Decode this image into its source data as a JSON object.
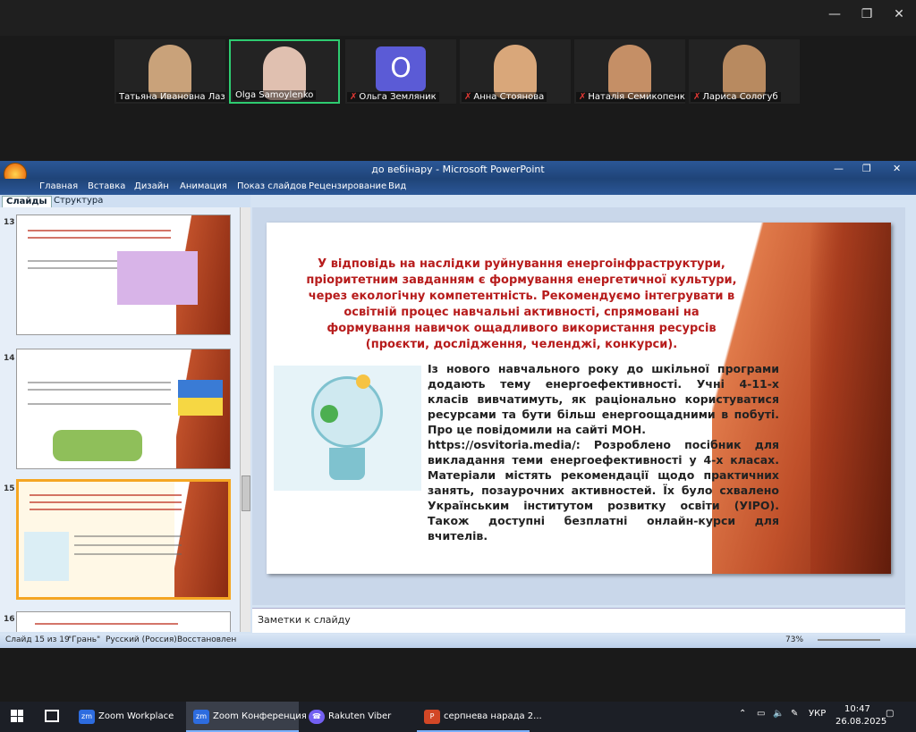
{
  "zoom": {
    "participants": [
      {
        "name": "Татьяна Ивановна Лаза...",
        "muted": false,
        "active": false
      },
      {
        "name": "Olga Samoylenko",
        "muted": false,
        "active": true
      },
      {
        "name": "Ольга Земляник",
        "muted": true,
        "active": false,
        "avatar_letter": "О"
      },
      {
        "name": "Анна Стоянова",
        "muted": true,
        "active": false
      },
      {
        "name": "Наталія Семикопенко",
        "muted": true,
        "active": false
      },
      {
        "name": "Лариса Сологуб",
        "muted": true,
        "active": false
      }
    ]
  },
  "ppt": {
    "title": "до вебінару - Microsoft PowerPoint",
    "menu": [
      "Главная",
      "Вставка",
      "Дизайн",
      "Анимация",
      "Показ слайдов",
      "Рецензирование",
      "Вид"
    ],
    "panel_tabs": [
      "Слайды",
      "Структура"
    ],
    "thumb_numbers": [
      "13",
      "14",
      "15",
      "16"
    ],
    "slide": {
      "paragraph1": "У відповідь на наслідки руйнування енергоінфраструктури, пріоритетним завданням є формування енергетичної культури, через екологічну компетентність. Рекомендуємо інтегрувати в освітній процес навчальні активності, спрямовані на формування навичок ощадливого використання ресурсів (проєкти, дослідження, челенджі, конкурси).",
      "paragraph2": "Із нового навчального року до шкільної програми додають тему енергоефективності. Учні 4-11-х класів вивчатимуть, як раціонально користуватися ресурсами та бути більш енергоощадними в побуті. Про це повідомили на сайті МОН.",
      "paragraph3": "https://osvitoria.media/: Розроблено посібник для викладання теми енергоефективності у 4-х класах. Матеріали містять рекомендації щодо практичних занять, позаурочних активностей. Їх було схвалено Українським інститутом розвитку освіти (УІРО). Також доступні безплатні онлайн-курси для вчителів."
    },
    "notes_placeholder": "Заметки к слайду",
    "status": {
      "slide_info": "Слайд 15 из 19",
      "theme": "\"Грань\"",
      "language": "Русский (Россия)",
      "restored": "Восстановлен",
      "zoom": "73%"
    }
  },
  "taskbar": {
    "apps": [
      {
        "label": "Zoom Workplace",
        "icon": "zoom-icon",
        "color": "#2d6cdf"
      },
      {
        "label": "Zoom Конференция",
        "icon": "zoom-icon",
        "color": "#2d6cdf"
      },
      {
        "label": "Rakuten Viber",
        "icon": "viber-icon",
        "color": "#7360f2"
      },
      {
        "label": "серпнева нарада 2...",
        "icon": "powerpoint-icon",
        "color": "#d24726"
      }
    ],
    "language": "УКР",
    "time": "10:47",
    "date": "26.08.2025"
  }
}
